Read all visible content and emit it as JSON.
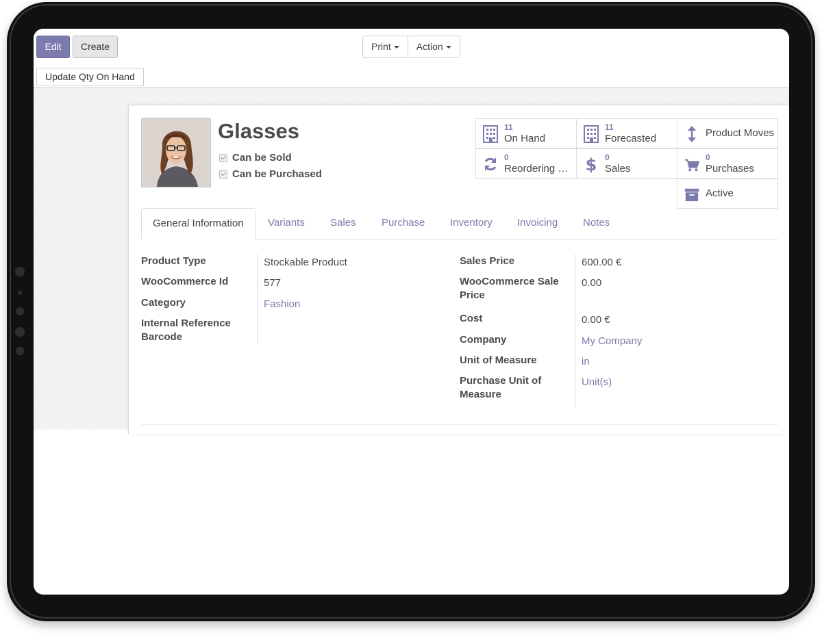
{
  "toolbar": {
    "edit_label": "Edit",
    "create_label": "Create",
    "print_label": "Print",
    "action_label": "Action"
  },
  "statusbar": {
    "update_qty_label": "Update Qty On Hand"
  },
  "product": {
    "name": "Glasses",
    "can_be_sold": "Can be Sold",
    "can_be_purchased": "Can be Purchased"
  },
  "smart_buttons": {
    "on_hand": {
      "count": "11",
      "label": "On Hand",
      "icon": "building-icon"
    },
    "forecasted": {
      "count": "11",
      "label": "Forecasted",
      "icon": "building-icon"
    },
    "product_moves": {
      "label": "Product Moves",
      "icon": "vertical-arrows-icon"
    },
    "reordering": {
      "count": "0",
      "label": "Reordering R...",
      "icon": "refresh-icon"
    },
    "sales": {
      "count": "0",
      "label": "Sales",
      "icon": "dollar-icon"
    },
    "purchases": {
      "count": "0",
      "label": "Purchases",
      "icon": "cart-icon"
    },
    "active": {
      "label": "Active",
      "icon": "archive-icon"
    }
  },
  "tabs": [
    "General Information",
    "Variants",
    "Sales",
    "Purchase",
    "Inventory",
    "Invoicing",
    "Notes"
  ],
  "left_fields": {
    "product_type": {
      "label": "Product Type",
      "value": "Stockable Product"
    },
    "woocommerce_id": {
      "label": "WooCommerce Id",
      "value": "577"
    },
    "category": {
      "label": "Category",
      "value": "Fashion"
    },
    "internal_reference": {
      "label": "Internal Reference",
      "value": ""
    },
    "barcode": {
      "label": "Barcode",
      "value": ""
    }
  },
  "right_fields": {
    "sales_price": {
      "label": "Sales Price",
      "value": "600.00 €"
    },
    "woocommerce_sale_price": {
      "label_line1": "WooCommerce Sale",
      "label_line2": "Price",
      "value": "0.00"
    },
    "cost": {
      "label": "Cost",
      "value": "0.00 €"
    },
    "company": {
      "label": "Company",
      "value": "My Company"
    },
    "uom": {
      "label": "Unit of Measure",
      "value": "in"
    },
    "purchase_uom": {
      "label_line1": "Purchase Unit of",
      "label_line2": "Measure",
      "value": "Unit(s)"
    }
  },
  "colors": {
    "accent": "#7c7bad",
    "text": "#4c4c4c",
    "bezel": "#111111"
  }
}
